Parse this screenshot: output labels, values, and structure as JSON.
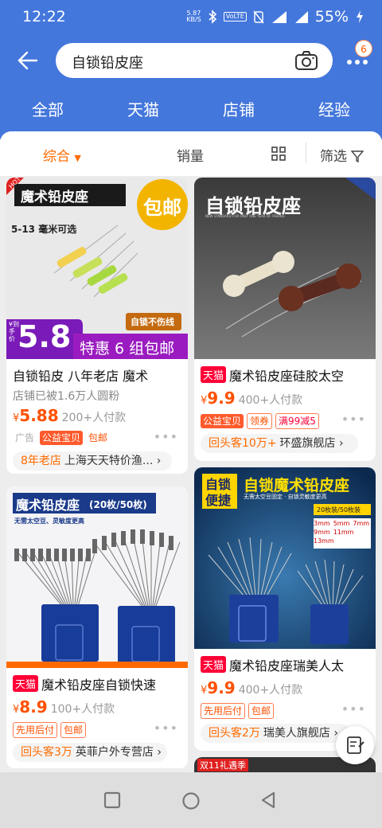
{
  "status": {
    "time": "12:22",
    "speed_top": "5.87",
    "speed_bottom": "KB/S",
    "volte": "VoLTE",
    "net": "4G",
    "battery": "55%"
  },
  "search": {
    "query": "自锁铅皮座",
    "badge": "6"
  },
  "tabs": [
    "全部",
    "天猫",
    "店铺",
    "经验"
  ],
  "sort": {
    "comprehensive": "综合",
    "sales": "销量",
    "filter": "筛选"
  },
  "products": [
    {
      "img": {
        "banner": "魔术铅皮座",
        "free": "包邮",
        "hot": "HOT",
        "size": "5-13 毫米可选",
        "badge": "自锁不伤线",
        "price_label": "¥到手价",
        "price": "5.8",
        "promo": "特惠 6 组包邮"
      },
      "title": "自锁铅皮 八年老店 魔术",
      "sub": "店铺已被1.6万人圆粉",
      "yen": "¥",
      "price": "5.88",
      "sold": "200+人付款",
      "tags": [
        "广告",
        "公益宝贝",
        "包邮"
      ],
      "shop_highlight": "8年老店",
      "shop": "上海天天特价渔..."
    },
    {
      "img": {
        "title": "自锁铅皮座",
        "subtitle": "NEW STANDARD FOR ONLY ONE YEAR OF FISHING"
      },
      "tmall": "天猫",
      "title": "魔术铅皮座硅胶太空",
      "yen": "¥",
      "price": "9.9",
      "sold": "400+人付款",
      "tags": [
        "公益宝贝",
        "领券",
        "满99减5"
      ],
      "shop_highlight": "回头客10万+",
      "shop": "环盛旗舰店"
    },
    {
      "img": {
        "banner": "魔术铅皮座",
        "count": "(20枚/50枚)",
        "sub": "无需太空豆、灵敏度更高"
      },
      "tmall": "天猫",
      "title": "魔术铅皮座自锁快速",
      "yen": "¥",
      "price": "8.9",
      "sold": "100+人付款",
      "tags": [
        "先用后付",
        "包邮"
      ],
      "shop_highlight": "回头客3万",
      "shop": "英菲户外专营店"
    },
    {
      "img": {
        "t1": "自锁",
        "t2": "便捷",
        "title": "自锁魔术铅皮座",
        "sub": "无需太空豆固定 · 自锁灵敏度更高",
        "count": "20枚装/50枚装",
        "sizes": [
          "3mm",
          "5mm",
          "7mm",
          "9mm",
          "11mm",
          "13mm"
        ]
      },
      "tmall": "天猫",
      "title": "魔术铅皮座瑞美人太",
      "yen": "¥",
      "price": "9.9",
      "sold": "400+人付款",
      "tags": [
        "先用后付",
        "包邮"
      ],
      "shop_highlight": "回头客2万",
      "shop": "瑞美人旗舰店"
    }
  ],
  "peek": {
    "badge": "双11礼遇季"
  },
  "colors": {
    "header": "#4477dc",
    "accent": "#ff6a00",
    "price": "#ff5000",
    "tmall": "#ff0036"
  }
}
